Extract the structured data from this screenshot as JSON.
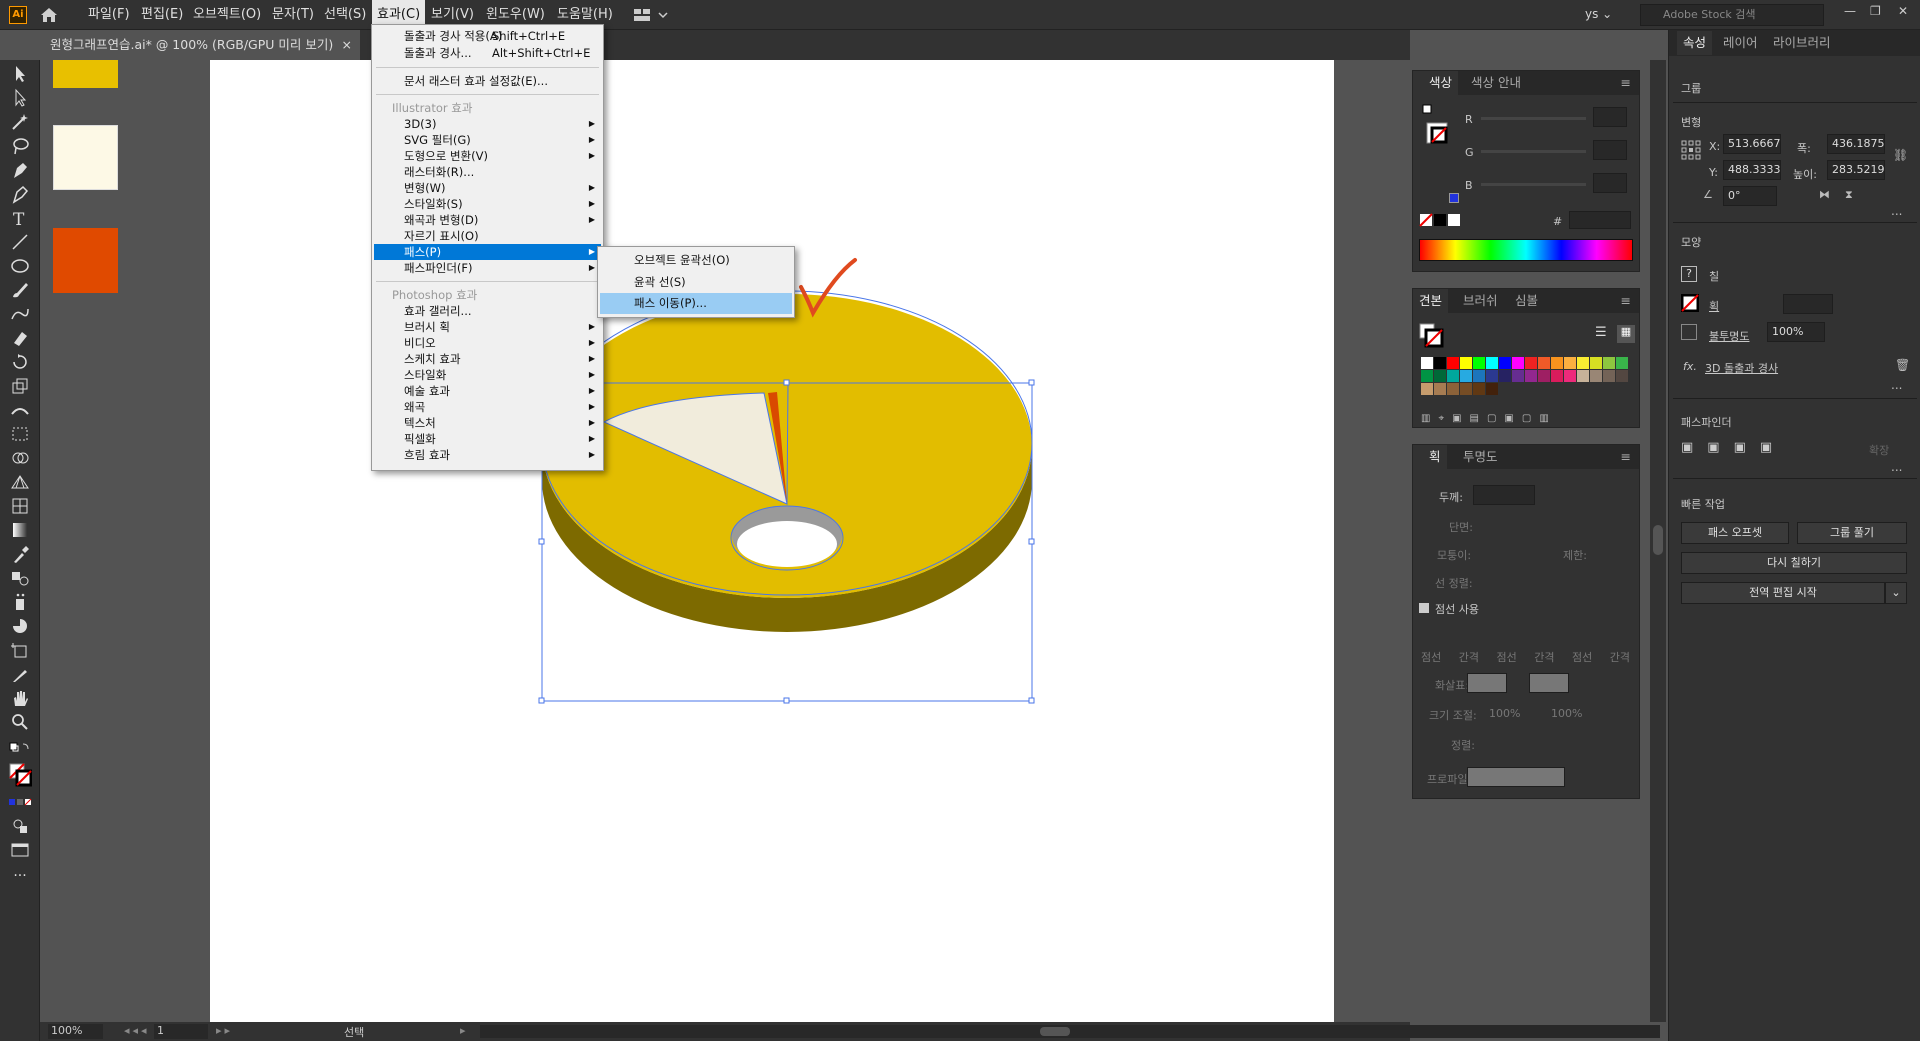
{
  "menubar": {
    "items": [
      "파일(F)",
      "편집(E)",
      "오브젝트(O)",
      "문자(T)",
      "선택(S)",
      "효과(C)",
      "보기(V)",
      "윈도우(W)",
      "도움말(H)"
    ],
    "app_logo": "Ai",
    "user": "ys",
    "search_placeholder": "Adobe Stock 검색"
  },
  "document": {
    "tab_title": "원형그래프연습.ai* @ 100% (RGB/GPU 미리 보기)",
    "close_glyph": "×"
  },
  "effect_menu": {
    "apply_last": "돌출과 경사 적용(A)",
    "apply_last_shortcut": "Shift+Ctrl+E",
    "last_effect": "돌출과 경사...",
    "last_effect_shortcut": "Alt+Shift+Ctrl+E",
    "raster_settings": "문서 래스터 효과 설정값(E)...",
    "illustrator_header": "Illustrator 효과",
    "illustrator_items": [
      "3D(3)",
      "SVG 필터(G)",
      "도형으로 변환(V)",
      "래스터화(R)...",
      "변형(W)",
      "스타일화(S)",
      "왜곡과 변형(D)",
      "자르기 표시(O)",
      "패스(P)",
      "패스파인더(F)"
    ],
    "photoshop_header": "Photoshop 효과",
    "photoshop_items": [
      "효과 갤러리...",
      "브러시 획",
      "비디오",
      "스케치 효과",
      "스타일화",
      "예술 효과",
      "왜곡",
      "텍스처",
      "픽셀화",
      "흐림 효과"
    ]
  },
  "path_submenu": {
    "items": [
      "오브젝트 윤곽선(O)",
      "윤곽 선(S)",
      "패스 이동(P)..."
    ]
  },
  "color_panel": {
    "tabs": [
      "색상",
      "색상 안내"
    ],
    "channels": [
      "R",
      "G",
      "B"
    ],
    "hex_symbol": "#"
  },
  "swatches_panel": {
    "tabs": [
      "견본",
      "브러쉬",
      "심볼"
    ],
    "colors": [
      "#ffffff",
      "#000000",
      "#ff0000",
      "#ffff00",
      "#00ff00",
      "#00ffff",
      "#0000ff",
      "#ff00ff",
      "#ee2222",
      "#f05a28",
      "#f7931e",
      "#fbb040",
      "#f9ed32",
      "#d7df23",
      "#8dc63f",
      "#39b54a",
      "#009444",
      "#006838",
      "#00a79d",
      "#27aae1",
      "#1c75bc",
      "#2b3990",
      "#262262",
      "#662d91",
      "#92278f",
      "#9e1f63",
      "#da1c5c",
      "#ee2a7b",
      "#c7b299",
      "#998675",
      "#736357",
      "#534741",
      "#c69c6d",
      "#a67c52",
      "#8c6239",
      "#754c24",
      "#603813",
      "#42210b"
    ]
  },
  "stroke_panel": {
    "tabs": [
      "획",
      "투명도"
    ],
    "weight_label": "두께:",
    "cap_label": "단면:",
    "corner_label": "모퉁이:",
    "limit_label": "제한:",
    "align_label": "선 정렬:",
    "dash_label": "점선 사용",
    "dash_cols": [
      "점선",
      "간격",
      "점선",
      "간격",
      "점선",
      "간격"
    ],
    "arrow_label": "화살표:",
    "scale_label": "크기 조절:",
    "scale_values": [
      "100%",
      "100%"
    ],
    "align_arrow_label": "정렬:",
    "profile_label": "프로파일:"
  },
  "properties": {
    "tabs": [
      "속성",
      "레이어",
      "라이브러리"
    ],
    "object_type": "그룹",
    "transform_title": "변형",
    "x_label": "X:",
    "x_value": "513.6667",
    "y_label": "Y:",
    "y_value": "488.3333",
    "w_label": "폭:",
    "w_value": "436.1875",
    "h_label": "높이:",
    "h_value": "283.5219",
    "angle_value": "0°",
    "appearance_title": "모양",
    "fill_label": "칠",
    "stroke_label": "획",
    "opacity_label": "불투명도",
    "opacity_value": "100%",
    "effect_name": "3D 돌출과 경사",
    "fx_label": "fx.",
    "pathfinder_title": "패스파인더",
    "expand_label": "확장",
    "quick_title": "빠른 작업",
    "offset_path_btn": "패스 오프셋",
    "ungroup_btn": "그룹 풀기",
    "recolor_btn": "다시 칠하기",
    "global_edit_btn": "전역 편집 시작",
    "more": "..."
  },
  "statusbar": {
    "zoom": "100%",
    "page": "1",
    "mode": "선택"
  },
  "chart_colors": {
    "main": "#e2bd00",
    "main_dark": "#7d6a00",
    "slice_light": "#f1ecdc",
    "slice_red": "#d94a00",
    "hole": "#9a9a9a",
    "selection": "#4a76e8",
    "check": "#e04a1f"
  }
}
